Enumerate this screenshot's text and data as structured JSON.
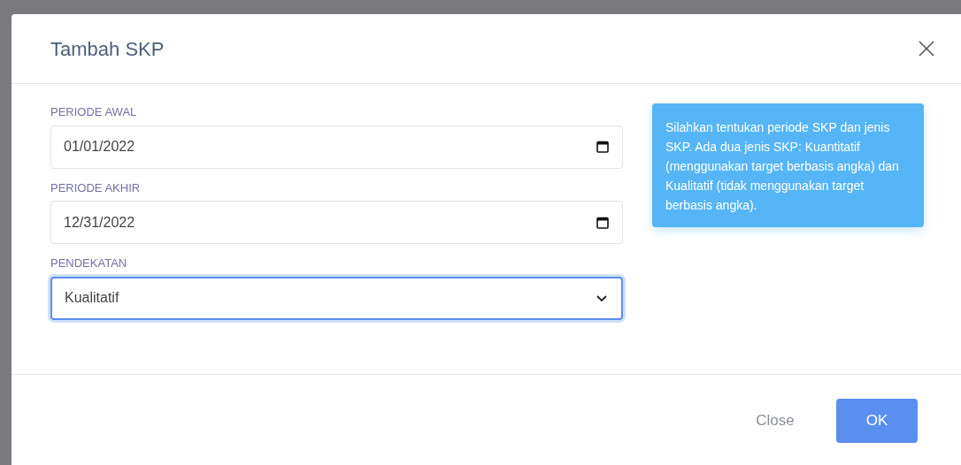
{
  "dialog": {
    "title": "Tambah SKP",
    "fields": [
      {
        "kind": "date",
        "label": "PERIODE AWAL",
        "value": "01/01/2022",
        "focused": false
      },
      {
        "kind": "date",
        "label": "PERIODE AKHIR",
        "value": "12/31/2022",
        "focused": false
      },
      {
        "kind": "select",
        "label": "PENDEKATAN",
        "value": "Kualitatif",
        "focused": true
      }
    ],
    "info": "Silahkan tentukan periode SKP dan jenis SKP. Ada dua jenis SKP: Kuantitatif (menggunakan target berbasis angka) dan Kualitatif (tidak menggunakan target berbasis angka).",
    "buttons": [
      {
        "kind": "secondary",
        "label": "Close"
      },
      {
        "kind": "primary",
        "label": "OK"
      }
    ]
  }
}
